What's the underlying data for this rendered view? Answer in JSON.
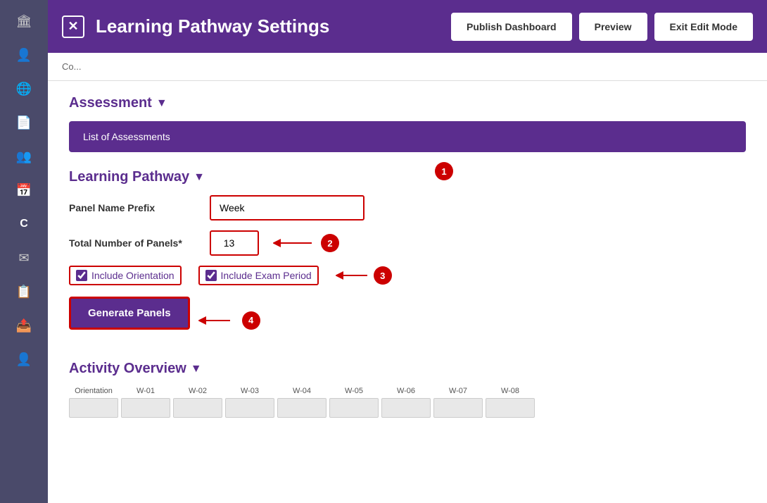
{
  "sidebar": {
    "icons": [
      {
        "name": "home-icon",
        "glyph": "🏛"
      },
      {
        "name": "user-icon",
        "glyph": "👤"
      },
      {
        "name": "globe-icon",
        "glyph": "🌐"
      },
      {
        "name": "document-icon",
        "glyph": "📄"
      },
      {
        "name": "users-icon",
        "glyph": "👥"
      },
      {
        "name": "calendar-icon",
        "glyph": "📅"
      },
      {
        "name": "c-icon",
        "glyph": "C"
      },
      {
        "name": "mail-icon",
        "glyph": "✉"
      },
      {
        "name": "file-icon",
        "glyph": "📋"
      },
      {
        "name": "export-icon",
        "glyph": "📤"
      },
      {
        "name": "user2-icon",
        "glyph": "👤"
      }
    ]
  },
  "header": {
    "title": "Learning Pathway Settings",
    "close_label": "✕",
    "buttons": {
      "publish": "Publish Dashboard",
      "preview": "Preview",
      "exit": "Exit Edit Mode"
    }
  },
  "subheader": {
    "breadcrumb": "Co..."
  },
  "assessment": {
    "section_title": "Assessment",
    "bar_text": "List of Assessments"
  },
  "learning_pathway": {
    "section_title": "Learning Pathway",
    "panel_name_prefix_label": "Panel Name Prefix",
    "panel_name_prefix_value": "Week",
    "total_panels_label": "Total Number of Panels*",
    "total_panels_value": "13",
    "include_orientation_label": "Include Orientation",
    "include_exam_period_label": "Include Exam Period",
    "include_orientation_checked": true,
    "include_exam_period_checked": true,
    "generate_button_label": "Generate Panels"
  },
  "activity_overview": {
    "section_title": "Activity Overview",
    "columns": [
      "Orientation",
      "W-01",
      "W-02",
      "W-03",
      "W-04",
      "W-05",
      "W-06",
      "W-07",
      "W-08"
    ]
  },
  "annotations": [
    {
      "number": "1",
      "description": "Panel Name Prefix arrow"
    },
    {
      "number": "2",
      "description": "Total Panels arrow"
    },
    {
      "number": "3",
      "description": "Include Exam Period arrow"
    },
    {
      "number": "4",
      "description": "Generate Panels arrow"
    }
  ]
}
